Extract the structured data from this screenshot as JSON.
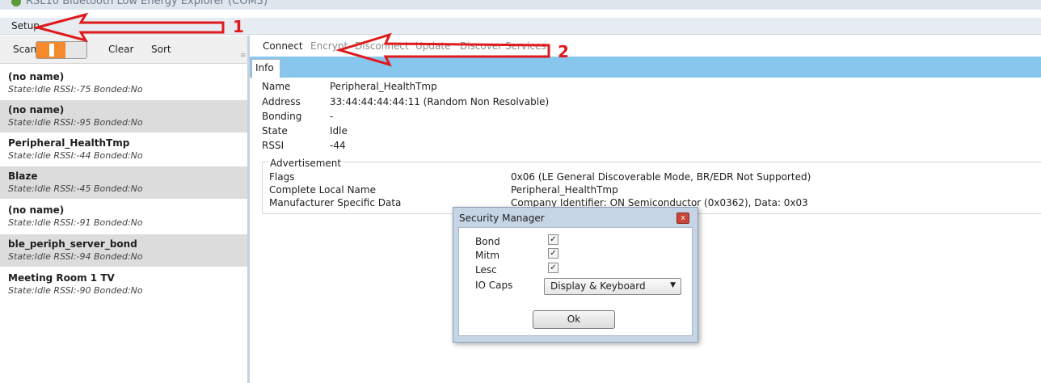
{
  "window": {
    "title": "RSL10 Bluetooth Low Energy Explorer (COM3)"
  },
  "menu": {
    "setup": "Setup"
  },
  "left_toolbar": {
    "scan": "Scan",
    "clear": "Clear",
    "sort": "Sort",
    "scan_on": true
  },
  "devices": [
    {
      "name": "(no name)",
      "info": "State:Idle RSSI:-75 Bonded:No"
    },
    {
      "name": "(no name)",
      "info": "State:Idle RSSI:-95 Bonded:No"
    },
    {
      "name": "Peripheral_HealthTmp",
      "info": "State:Idle RSSI:-44 Bonded:No"
    },
    {
      "name": "Blaze",
      "info": "State:Idle RSSI:-45 Bonded:No"
    },
    {
      "name": "(no name)",
      "info": "State:Idle RSSI:-91 Bonded:No"
    },
    {
      "name": "ble_periph_server_bond",
      "info": "State:Idle RSSI:-94 Bonded:No"
    },
    {
      "name": "Meeting Room 1 TV",
      "info": "State:Idle RSSI:-90 Bonded:No"
    }
  ],
  "toolbar": {
    "connect": "Connect",
    "encrypt": "Encrypt",
    "disconnect": "Disconnect",
    "update": "Update",
    "discover_services": "Discover Services"
  },
  "tabs": {
    "info": "Info"
  },
  "info": {
    "name_label": "Name",
    "name_value": "Peripheral_HealthTmp",
    "address_label": "Address",
    "address_value": "33:44:44:44:44:11 (Random Non Resolvable)",
    "bonding_label": "Bonding",
    "bonding_value": "-",
    "state_label": "State",
    "state_value": "Idle",
    "rssi_label": "RSSI",
    "rssi_value": "-44"
  },
  "advertisement": {
    "title": "Advertisement",
    "flags_label": "Flags",
    "flags_value": "0x06 (LE General Discoverable Mode, BR/EDR Not Supported)",
    "local_name_label": "Complete Local Name",
    "local_name_value": "Peripheral_HealthTmp",
    "manufacturer_label": "Manufacturer Specific Data",
    "manufacturer_value": "Company Identifier: ON Semiconductor (0x0362), Data: 0x03"
  },
  "dialog": {
    "title": "Security Manager",
    "bond_label": "Bond",
    "bond_checked": true,
    "mitm_label": "Mitm",
    "mitm_checked": true,
    "lesc_label": "Lesc",
    "lesc_checked": true,
    "io_caps_label": "IO Caps",
    "io_caps_value": "Display & Keyboard",
    "ok": "Ok",
    "close_glyph": "x",
    "check_glyph": "✓",
    "dropdown_glyph": "▼"
  },
  "annotations": {
    "one": "1",
    "two": "2",
    "color": "#e0191c"
  },
  "colors": {
    "accent_tab": "#87c7ee",
    "toggle_on": "#f58a2d",
    "dialog_frame": "#c6d5e6"
  }
}
